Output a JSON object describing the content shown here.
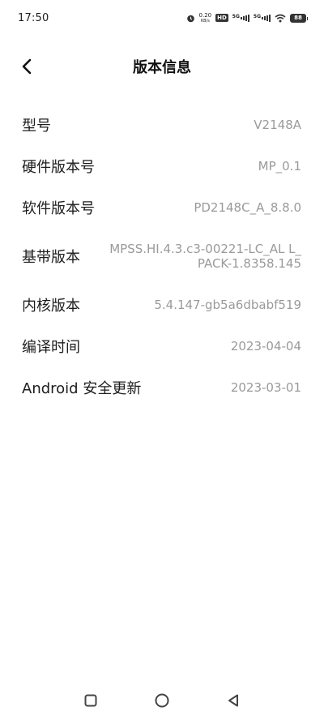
{
  "status_bar": {
    "time": "17:50",
    "net_speed_value": "0.20",
    "net_speed_unit": "KB/s",
    "hd_badge": "HD",
    "sim1_label": "5G",
    "sim2_label": "5G",
    "battery_level": "88"
  },
  "header": {
    "title": "版本信息"
  },
  "info": {
    "items": [
      {
        "label": "型号",
        "value": "V2148A"
      },
      {
        "label": "硬件版本号",
        "value": "MP_0.1"
      },
      {
        "label": "软件版本号",
        "value": "PD2148C_A_8.8.0"
      },
      {
        "label": "基带版本",
        "value": "MPSS.HI.4.3.c3-00221-LC_AL L_PACK-1.8358.145"
      },
      {
        "label": "内核版本",
        "value": "5.4.147-gb5a6dbabf519"
      },
      {
        "label": "编译时间",
        "value": "2023-04-04"
      },
      {
        "label": "Android 安全更新",
        "value": "2023-03-01"
      }
    ]
  },
  "icons": {
    "back": "chevron-left-icon",
    "recents": "square-icon",
    "home": "circle-icon",
    "nav_back": "triangle-left-icon"
  },
  "colors": {
    "background": "#ffffff",
    "label": "#1d1d1d",
    "value": "#9a9a9a"
  }
}
